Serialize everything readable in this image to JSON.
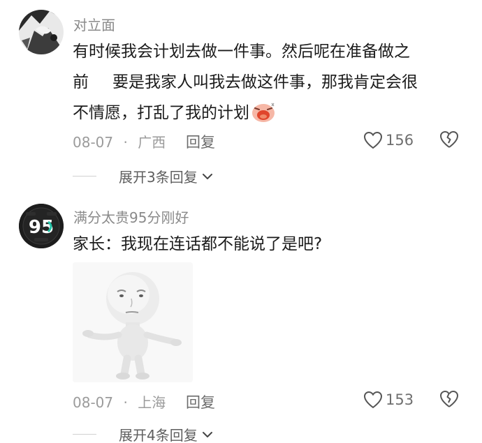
{
  "comments": [
    {
      "username": "对立面",
      "text_line1": "有时候我会计划去做一件事。然后呢在准备做之",
      "text_line2_a": "前",
      "text_line2_b": "要是我家人叫我去做这件事，那我肯定会很",
      "text_line3": "不情愿，打乱了我的计划",
      "date": "08-07",
      "dot": "·",
      "location": "广西",
      "reply_label": "回复",
      "likes": "156",
      "expand_label": "展开3条回复"
    },
    {
      "username": "满分太贵95分刚好",
      "text_line1": "家长：我现在连话都不能说了是吧?",
      "date": "08-07",
      "dot": "·",
      "location": "上海",
      "reply_label": "回复",
      "likes": "153",
      "expand_label": "展开4条回复"
    }
  ],
  "icons": {
    "like": "heart-outline-icon",
    "dislike": "broken-heart-icon",
    "chevron": "chevron-down-icon"
  }
}
